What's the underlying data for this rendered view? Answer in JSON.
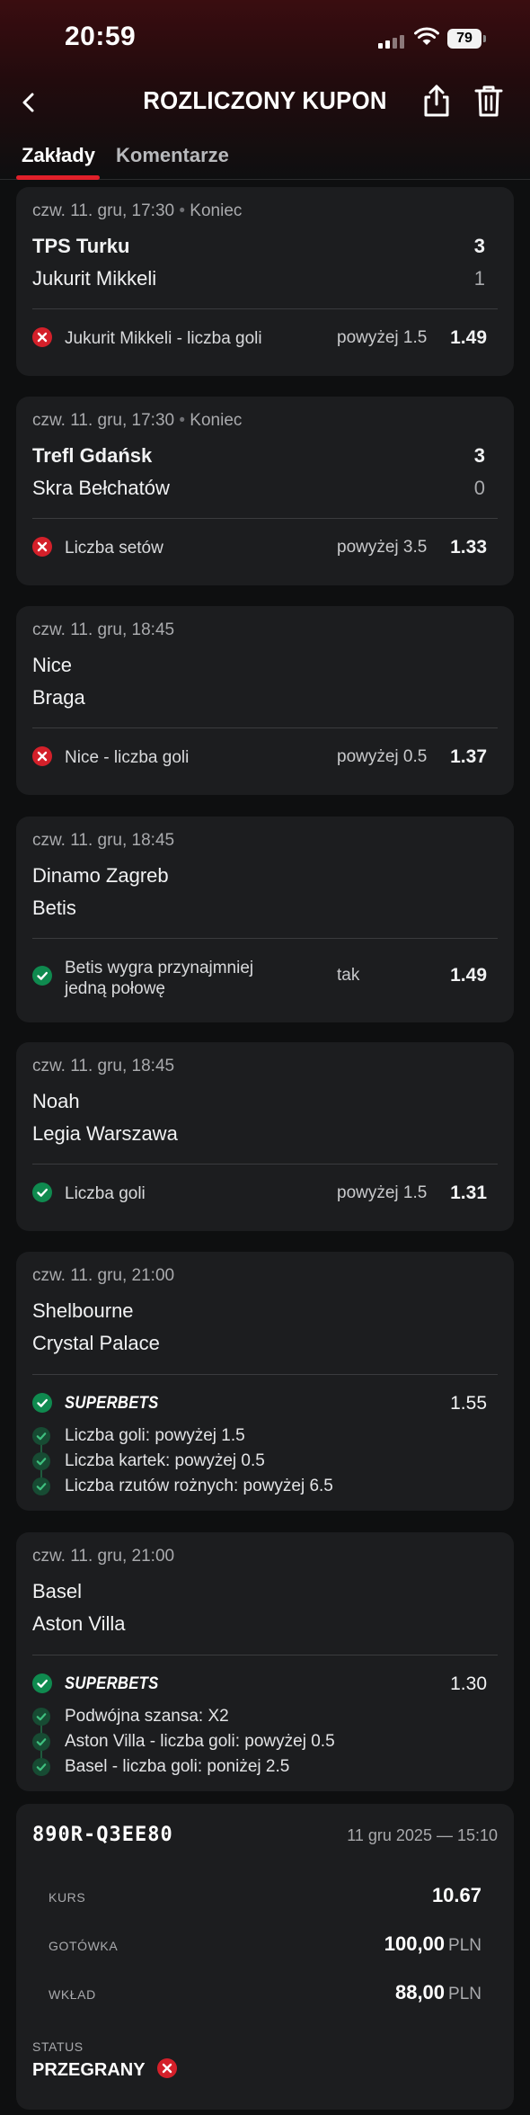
{
  "status_bar": {
    "time": "20:59",
    "battery": "79"
  },
  "header": {
    "title": "ROZLICZONY KUPON"
  },
  "tabs": [
    {
      "label": "Zakłady"
    },
    {
      "label": "Komentarze"
    }
  ],
  "bets": [
    {
      "date": "czw. 11. gru, 17:30",
      "state": "Koniec",
      "home": "TPS Turku",
      "home_score": "3",
      "away": "Jukurit Mikkeli",
      "away_score": "1",
      "selection": {
        "name": "Jukurit Mikkeli - liczba goli",
        "pick": "powyżej 1.5",
        "odds": "1.49",
        "result": "lost"
      }
    },
    {
      "date": "czw. 11. gru, 17:30",
      "state": "Koniec",
      "home": "Trefl Gdańsk",
      "home_score": "3",
      "away": "Skra Bełchatów",
      "away_score": "0",
      "selection": {
        "name": "Liczba setów",
        "pick": "powyżej 3.5",
        "odds": "1.33",
        "result": "lost"
      }
    },
    {
      "date": "czw. 11. gru, 18:45",
      "home": "Nice",
      "away": "Braga",
      "selection": {
        "name": "Nice - liczba goli",
        "pick": "powyżej 0.5",
        "odds": "1.37",
        "result": "lost"
      }
    },
    {
      "date": "czw. 11. gru, 18:45",
      "home": "Dinamo Zagreb",
      "away": "Betis",
      "selection": {
        "name_line1": "Betis wygra przynajmniej",
        "name_line2": "jedną połowę",
        "pick": "tak",
        "odds": "1.49",
        "result": "won"
      }
    },
    {
      "date": "czw. 11. gru, 18:45",
      "home": "Noah",
      "away": "Legia Warszawa",
      "selection": {
        "name": "Liczba goli",
        "pick": "powyżej 1.5",
        "odds": "1.31",
        "result": "won"
      }
    },
    {
      "date": "czw. 11. gru, 21:00",
      "home": "Shelbourne",
      "away": "Crystal Palace",
      "superbets": {
        "label": "SUPERBETS",
        "odds": "1.55",
        "result": "won",
        "items": [
          "Liczba goli: powyżej 1.5",
          "Liczba kartek: powyżej 0.5",
          "Liczba rzutów rożnych: powyżej 6.5"
        ]
      }
    },
    {
      "date": "czw. 11. gru, 21:00",
      "home": "Basel",
      "away": "Aston Villa",
      "superbets": {
        "label": "SUPERBETS",
        "odds": "1.30",
        "result": "won",
        "items": [
          "Podwójna szansa: X2",
          "Aston Villa - liczba goli: powyżej 0.5",
          "Basel - liczba goli: poniżej 2.5"
        ]
      }
    }
  ],
  "summary": {
    "code": "890R-Q3EE80",
    "timestamp": "11 gru 2025 — 15:10",
    "odds_label": "KURS",
    "odds_value": "10.67",
    "payout_label": "GOTÓWKA",
    "payout_value": "100,00",
    "payout_currency": "PLN",
    "stake_label": "WKŁAD",
    "stake_value": "88,00",
    "stake_currency": "PLN",
    "status_label": "STATUS",
    "status_value": "PRZEGRANY"
  },
  "colors": {
    "accent": "#e0202a",
    "won": "#0f8a4f",
    "lost": "#d4202a",
    "card": "#1c1d1f",
    "background": "#0e0f10"
  }
}
